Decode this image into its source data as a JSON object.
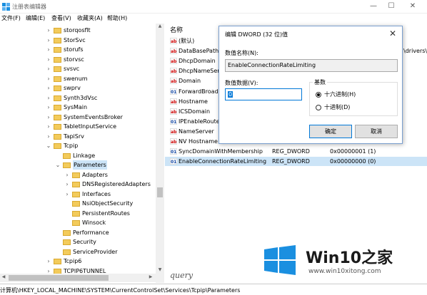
{
  "window": {
    "title": "注册表编辑器"
  },
  "menu": [
    "文件(F)",
    "编辑(E)",
    "查看(V)",
    "收藏夹(A)",
    "帮助(H)"
  ],
  "tree": [
    {
      "label": "storqosflt",
      "indent": 1,
      "expander": "›"
    },
    {
      "label": "StorSvc",
      "indent": 1,
      "expander": "›"
    },
    {
      "label": "storufs",
      "indent": 1,
      "expander": "›"
    },
    {
      "label": "storvsc",
      "indent": 1,
      "expander": "›"
    },
    {
      "label": "svsvc",
      "indent": 1,
      "expander": "›"
    },
    {
      "label": "swenum",
      "indent": 1,
      "expander": "›"
    },
    {
      "label": "swprv",
      "indent": 1,
      "expander": "›"
    },
    {
      "label": "Synth3dVsc",
      "indent": 1,
      "expander": "›"
    },
    {
      "label": "SysMain",
      "indent": 1,
      "expander": "›"
    },
    {
      "label": "SystemEventsBroker",
      "indent": 1,
      "expander": "›"
    },
    {
      "label": "TabletInputService",
      "indent": 1,
      "expander": "›"
    },
    {
      "label": "TapiSrv",
      "indent": 1,
      "expander": "›"
    },
    {
      "label": "Tcpip",
      "indent": 1,
      "expander": "⌄"
    },
    {
      "label": "Linkage",
      "indent": 2,
      "expander": ""
    },
    {
      "label": "Parameters",
      "indent": 2,
      "expander": "⌄",
      "selected": true
    },
    {
      "label": "Adapters",
      "indent": 3,
      "expander": "›"
    },
    {
      "label": "DNSRegisteredAdapters",
      "indent": 3,
      "expander": "›"
    },
    {
      "label": "Interfaces",
      "indent": 3,
      "expander": "›"
    },
    {
      "label": "NsiObjectSecurity",
      "indent": 3,
      "expander": ""
    },
    {
      "label": "PersistentRoutes",
      "indent": 3,
      "expander": ""
    },
    {
      "label": "Winsock",
      "indent": 3,
      "expander": ""
    },
    {
      "label": "Performance",
      "indent": 2,
      "expander": ""
    },
    {
      "label": "Security",
      "indent": 2,
      "expander": ""
    },
    {
      "label": "ServiceProvider",
      "indent": 2,
      "expander": ""
    },
    {
      "label": "Tcpip6",
      "indent": 1,
      "expander": "›"
    },
    {
      "label": "TCPIP6TUNNEL",
      "indent": 1,
      "expander": "›"
    }
  ],
  "list": {
    "col_name": "名称",
    "rows": [
      {
        "name": "(默认)",
        "type": "",
        "data": "",
        "icon": "ab"
      },
      {
        "name": "DataBasePath",
        "type": "",
        "data": "\\drivers\\",
        "icon": "ab"
      },
      {
        "name": "DhcpDomain",
        "type": "",
        "data": "",
        "icon": "ab"
      },
      {
        "name": "DhcpNameSer",
        "type": "",
        "data": "",
        "icon": "ab"
      },
      {
        "name": "Domain",
        "type": "",
        "data": "",
        "icon": "ab"
      },
      {
        "name": "ForwardBroad",
        "type": "",
        "data": "",
        "icon": "bin"
      },
      {
        "name": "Hostname",
        "type": "",
        "data": "",
        "icon": "ab"
      },
      {
        "name": "ICSDomain",
        "type": "",
        "data": "",
        "icon": "ab"
      },
      {
        "name": "IPEnableRoute",
        "type": "",
        "data": "",
        "icon": "bin"
      },
      {
        "name": "NameServer",
        "type": "",
        "data": "",
        "icon": "ab"
      },
      {
        "name": "NV Hostname",
        "type": "",
        "data": "",
        "icon": "ab"
      },
      {
        "name": "SyncDomainWithMembership",
        "type": "REG_DWORD",
        "data": "0x00000001 (1)",
        "icon": "bin"
      },
      {
        "name": "EnableConnectionRateLimiting",
        "type": "REG_DWORD",
        "data": "0x00000000 (0)",
        "icon": "bin",
        "selected": true
      }
    ]
  },
  "dialog": {
    "title": "编辑 DWORD (32 位)值",
    "name_label": "数值名称(N):",
    "name_value": "EnableConnectionRateLimiting",
    "data_label": "数值数据(V):",
    "data_value": "0",
    "base_label": "基数",
    "hex_label": "十六进制(H)",
    "dec_label": "十进制(D)",
    "base_selected": "hex",
    "ok_label": "确定",
    "cancel_label": "取消"
  },
  "statusbar": {
    "path": "计算机\\HKEY_LOCAL_MACHINE\\SYSTEM\\CurrentControlSet\\Services\\Tcpip\\Parameters"
  },
  "watermark": {
    "brand": "Win10之家",
    "url": "www.win10xitong.com",
    "signature": "query"
  },
  "colors": {
    "selection": "#cce4f7",
    "folder": "#f3cb5b",
    "accent": "#0078d7",
    "logo": "#1a8fe0"
  }
}
